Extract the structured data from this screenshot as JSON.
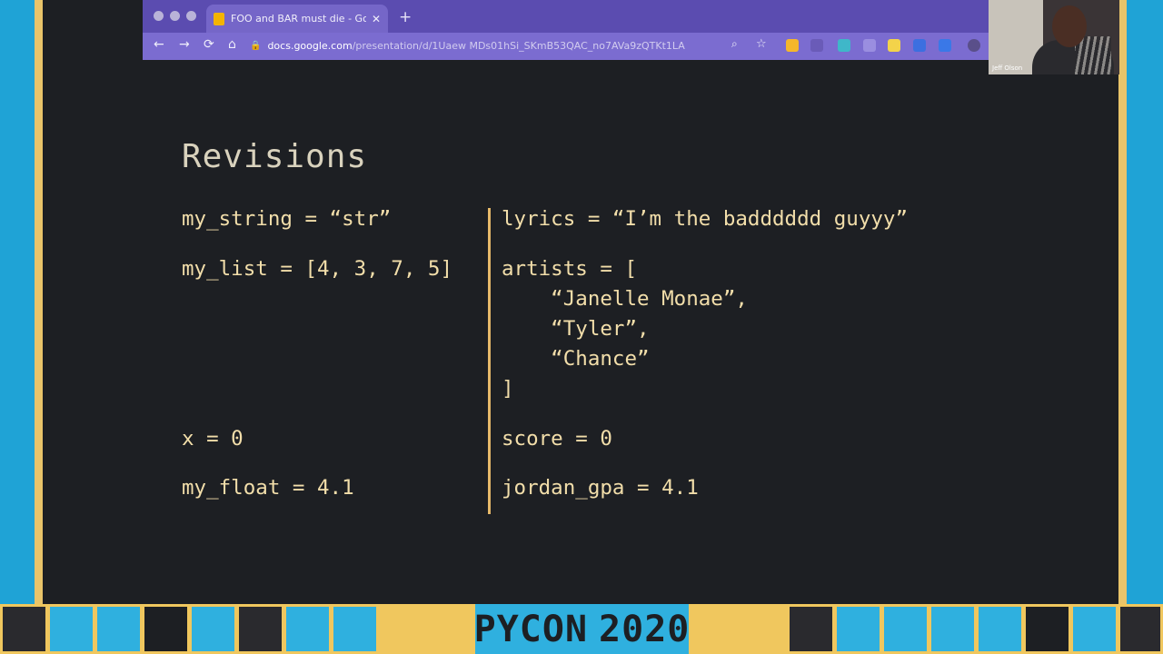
{
  "browser": {
    "tab_title": "FOO and BAR must die - Goog",
    "tab_close": "✕",
    "new_tab": "+",
    "url_host": "docs.google.com",
    "url_path": "/presentation/d/1Uaew MDs01hSi_SKmB53QAC_no7AVa9zQTKt1LA",
    "nav": {
      "back": "←",
      "forward": "→",
      "reload": "⟳",
      "home": "⌂"
    },
    "lock": "🔒"
  },
  "webcam": {
    "name": "Jeff Olson"
  },
  "slide": {
    "title": "Revisions",
    "left_lines": [
      "my_string = “str”",
      "my_list = [4, 3, 7, 5]",
      "x = 0",
      "my_float = 4.1"
    ],
    "right_lines": [
      "lyrics = “I’m the badddddd guyyy”",
      "artists = [",
      "    “Janelle Monae”,",
      "    “Tyler”,",
      "    “Chance”",
      "]",
      "score = 0",
      "jordan_gpa = 4.1"
    ]
  },
  "banner": {
    "pycon_word": "PYCON",
    "pycon_year": "2020"
  },
  "colors": {
    "frame_blue": "#1fa3d6",
    "frame_gold": "#e9c46a",
    "slide_bg": "#1d1f23",
    "code_text": "#f2deaa",
    "divider": "#e6b96a",
    "browser_purple": "#7b6cd0"
  }
}
